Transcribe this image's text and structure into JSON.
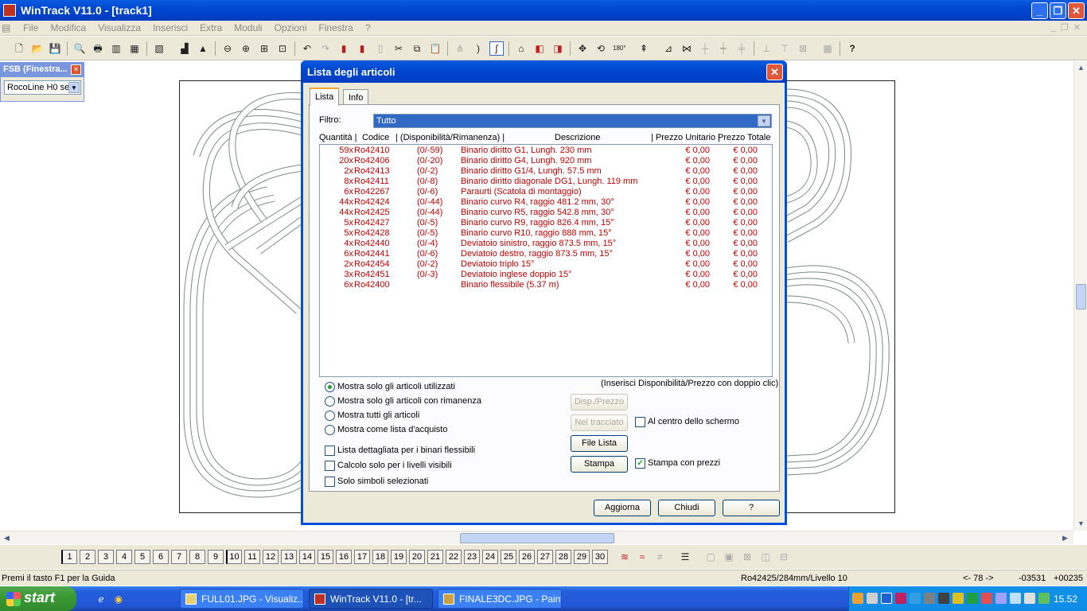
{
  "window": {
    "title": "WinTrack  V11.0 - [track1]",
    "controls": [
      "_",
      "❐",
      "✕"
    ]
  },
  "menu": [
    "File",
    "Modifica",
    "Visualizza",
    "Inserisci",
    "Extra",
    "Moduli",
    "Opzioni",
    "Finestra",
    "?"
  ],
  "fsb": {
    "title": "FSB (Finestra...",
    "select_value": "RocoLine H0 se"
  },
  "dialog": {
    "title": "Lista degli articoli",
    "tabs": [
      "Lista",
      "Info"
    ],
    "filter_label": "Filtro:",
    "filter_value": "Tutto",
    "columns": {
      "qty": "Quantità |",
      "code": "Codice",
      "avail": "| (Disponibilità/Rimanenza) |",
      "desc": "Descrizione",
      "unit": "| Prezzo Unitario |",
      "total": "Prezzo Totale"
    },
    "rows": [
      {
        "qty": "59x",
        "code": "Ro42410",
        "avail": "(0/-59)",
        "desc": "Binario diritto G1, Lungh. 230 mm",
        "unit": "€ 0,00",
        "total": "€ 0,00"
      },
      {
        "qty": "20x",
        "code": "Ro42406",
        "avail": "(0/-20)",
        "desc": "Binario diritto G4, Lungh. 920 mm",
        "unit": "€ 0,00",
        "total": "€ 0,00"
      },
      {
        "qty": "2x",
        "code": "Ro42413",
        "avail": "(0/-2)",
        "desc": "Binario diritto G1/4, Lungh. 57.5 mm",
        "unit": "€ 0,00",
        "total": "€ 0,00"
      },
      {
        "qty": "8x",
        "code": "Ro42411",
        "avail": "(0/-8)",
        "desc": "Binario diritto diagonale DG1, Lungh. 119 mm",
        "unit": "€ 0,00",
        "total": "€ 0,00"
      },
      {
        "qty": "6x",
        "code": "Ro42267",
        "avail": "(0/-6)",
        "desc": "Paraurti (Scatola di montaggio)",
        "unit": "€ 0,00",
        "total": "€ 0,00"
      },
      {
        "qty": "44x",
        "code": "Ro42424",
        "avail": "(0/-44)",
        "desc": "Binario curvo R4, raggio 481.2 mm, 30°",
        "unit": "€ 0,00",
        "total": "€ 0,00"
      },
      {
        "qty": "44x",
        "code": "Ro42425",
        "avail": "(0/-44)",
        "desc": "Binario curvo R5, raggio 542.8 mm, 30°",
        "unit": "€ 0,00",
        "total": "€ 0,00"
      },
      {
        "qty": "5x",
        "code": "Ro42427",
        "avail": "(0/-5)",
        "desc": "Binario curvo R9, raggio 826.4 mm, 15°",
        "unit": "€ 0,00",
        "total": "€ 0,00"
      },
      {
        "qty": "5x",
        "code": "Ro42428",
        "avail": "(0/-5)",
        "desc": "Binario curvo R10, raggio 888 mm, 15°",
        "unit": "€ 0,00",
        "total": "€ 0,00"
      },
      {
        "qty": "4x",
        "code": "Ro42440",
        "avail": "(0/-4)",
        "desc": "Deviatoio sinistro, raggio 873.5 mm, 15°",
        "unit": "€ 0,00",
        "total": "€ 0,00"
      },
      {
        "qty": "6x",
        "code": "Ro42441",
        "avail": "(0/-6)",
        "desc": "Deviatoio destro, raggio 873.5 mm, 15°",
        "unit": "€ 0,00",
        "total": "€ 0,00"
      },
      {
        "qty": "2x",
        "code": "Ro42454",
        "avail": "(0/-2)",
        "desc": "Deviatoio triplo 15°",
        "unit": "€ 0,00",
        "total": "€ 0,00"
      },
      {
        "qty": "3x",
        "code": "Ro42451",
        "avail": "(0/-3)",
        "desc": "Deviatoio inglese doppio 15°",
        "unit": "€ 0,00",
        "total": "€ 0,00"
      },
      {
        "qty": "6x",
        "code": "Ro42400",
        "avail": "",
        "desc": "Binario flessibile (5.37 m)",
        "unit": "€ 0,00",
        "total": "€ 0,00"
      }
    ],
    "hint": "(Inserisci Disponibilità/Prezzo con doppio clic)",
    "radios": [
      {
        "label": "Mostra solo gli articoli utilizzati",
        "checked": true
      },
      {
        "label": "Mostra solo gli articoli con rimanenza",
        "checked": false
      },
      {
        "label": "Mostra tutti gli articoli",
        "checked": false
      },
      {
        "label": "Mostra come lista d'acquisto",
        "checked": false
      }
    ],
    "checks": [
      {
        "label": "Lista dettagliata per i binari flessibili",
        "checked": false
      },
      {
        "label": "Calcolo solo per i livelli visibili",
        "checked": false
      },
      {
        "label": "Solo simboli selezionati",
        "checked": false
      }
    ],
    "btn_disp": "Disp./Prezzo",
    "btn_tracciato": "Nel tracciato",
    "chk_centro": "Al centro dello schermo",
    "btn_file": "File Lista",
    "btn_stampa": "Stampa",
    "chk_prezzi": "Stampa con prezzi",
    "btn_aggiorna": "Aggiorna",
    "btn_chiudi": "Chiudi",
    "btn_help": "?"
  },
  "layers": [
    "1",
    "2",
    "3",
    "4",
    "5",
    "6",
    "7",
    "8",
    "9",
    "10",
    "11",
    "12",
    "13",
    "14",
    "15",
    "16",
    "17",
    "18",
    "19",
    "20",
    "21",
    "22",
    "23",
    "24",
    "25",
    "26",
    "27",
    "28",
    "29",
    "30"
  ],
  "status": {
    "help": "Premi il tasto F1 per la Guida",
    "info": "Ro42425/284mm/Livello 10",
    "angle": "<- 78 ->",
    "x": "-03531",
    "y": "+00235"
  },
  "taskbar": {
    "start": "start",
    "tasks": [
      "FULL01.JPG - Visualiz...",
      "WinTrack  V11.0 - [tr...",
      "FINALE3DC.JPG - Paint"
    ],
    "clock": "15.52"
  }
}
